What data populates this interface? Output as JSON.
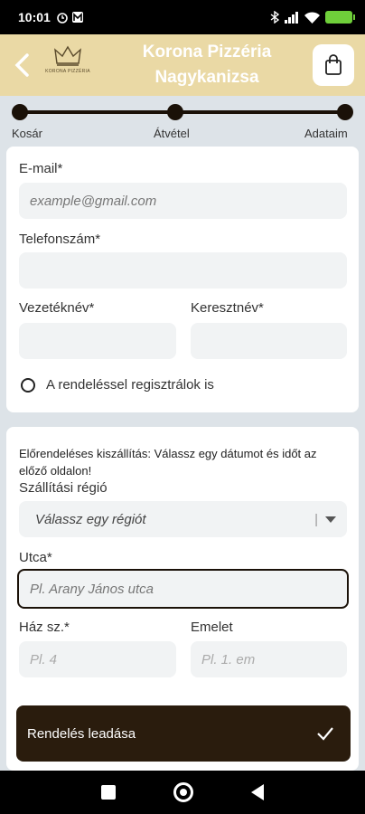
{
  "status": {
    "time": "10:01",
    "left_icons": [
      "alarm-icon",
      "m-icon"
    ],
    "right_icons": [
      "bluetooth-icon",
      "signal-icon",
      "wifi-icon",
      "battery-icon"
    ]
  },
  "header": {
    "title": "Korona Pizzéria Nagykanizsa",
    "logo_text": "KORONA PIZZÉRIA",
    "back_icon": "chevron-left-icon",
    "cart_icon": "shopping-bag-icon",
    "colors": {
      "background": "#ead9a5",
      "title": "#ffffff"
    }
  },
  "stepper": {
    "steps": [
      "Kosár",
      "Átvétel",
      "Adataim"
    ]
  },
  "contact": {
    "email_label": "E-mail*",
    "email_placeholder": "example@gmail.com",
    "phone_label": "Telefonszám*",
    "lastname_label": "Vezetéknév*",
    "firstname_label": "Keresztnév*",
    "register_label": "A rendeléssel regisztrálok is"
  },
  "delivery": {
    "notice": "Előrendeléses kiszállítás: Válassz egy dátumot és időt az előző oldalon!",
    "region_label": "Szállítási régió",
    "region_placeholder": "Válassz egy régiót",
    "street_label": "Utca*",
    "street_placeholder": "Pl. Arany János utca",
    "house_label": "Ház sz.*",
    "house_placeholder": "Pl. 4",
    "floor_label": "Emelet",
    "floor_placeholder": "Pl. 1. em"
  },
  "submit": {
    "label": "Rendelés leadása",
    "icon": "check-icon",
    "color": "#2a1c0d"
  }
}
